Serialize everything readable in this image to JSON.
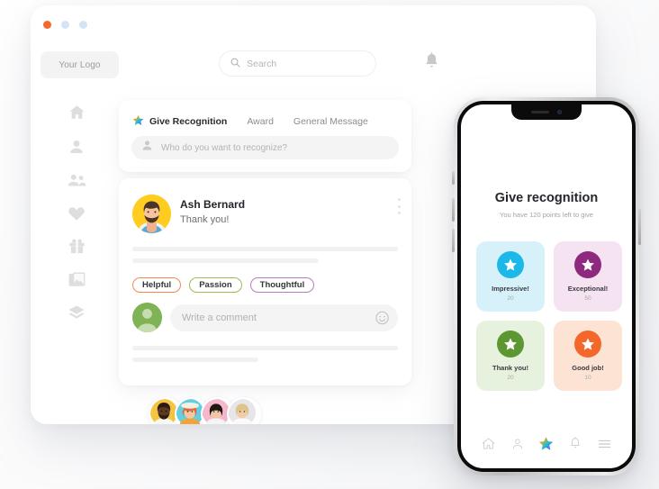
{
  "window": {
    "dots": [
      "#f8682c",
      "#d4e4f7",
      "#d4e4f7"
    ],
    "logo_label": "Your Logo",
    "search": {
      "placeholder": "Search",
      "icon": "search-icon"
    },
    "bell_icon": "bell-icon"
  },
  "sidebar": {
    "items": [
      {
        "icon": "home-icon",
        "name": "home"
      },
      {
        "icon": "person-icon",
        "name": "profile"
      },
      {
        "icon": "people-icon",
        "name": "team"
      },
      {
        "icon": "heart-icon",
        "name": "favorites"
      },
      {
        "icon": "gift-icon",
        "name": "rewards"
      },
      {
        "icon": "images-icon",
        "name": "gallery"
      },
      {
        "icon": "layers-icon",
        "name": "layers"
      }
    ]
  },
  "compose": {
    "tabs": [
      {
        "label": "Give Recognition",
        "active": true,
        "icon": "star-icon"
      },
      {
        "label": "Award",
        "active": false
      },
      {
        "label": "General Message",
        "active": false
      }
    ],
    "recipient_placeholder": "Who do you want to recognize?",
    "recipient_icon": "person-icon"
  },
  "post": {
    "author": "Ash Bernard",
    "message": "Thank you!",
    "menu_icon": "more-vertical-icon",
    "avatar_bg": "#ffcc1f",
    "tags": [
      {
        "label": "Helpful",
        "color": "#f6894d"
      },
      {
        "label": "Passion",
        "color": "#9cbc52"
      },
      {
        "label": "Thoughtful",
        "color": "#b87cc0"
      }
    ],
    "comment_placeholder": "Write a comment",
    "emoji_icon": "smiley-icon"
  },
  "avatar_stack": [
    {
      "name": "avatar-1",
      "bg": "#f5c542"
    },
    {
      "name": "avatar-2",
      "bg": "#63cfe3"
    },
    {
      "name": "avatar-3",
      "bg": "#f7b7cd"
    },
    {
      "name": "avatar-4",
      "bg": "#e6e6e8"
    }
  ],
  "phone": {
    "title": "Give recognition",
    "subtitle": "You have 120 points left to give",
    "rewards": [
      {
        "label": "Impressive!",
        "points": "20",
        "badge": "#1cb8e8",
        "bg": "#d7f1fb",
        "icon": "star-icon"
      },
      {
        "label": "Exceptional!",
        "points": "50",
        "badge": "#8e2a7e",
        "bg": "#f6e3f2",
        "icon": "star-icon"
      },
      {
        "label": "Thank you!",
        "points": "20",
        "badge": "#5d9732",
        "bg": "#e6f2dd",
        "icon": "star-icon"
      },
      {
        "label": "Good job!",
        "points": "10",
        "badge": "#f4672a",
        "bg": "#fde3d4",
        "icon": "star-icon"
      }
    ],
    "nav": [
      {
        "icon": "home-icon",
        "name": "home",
        "active": false
      },
      {
        "icon": "person-icon",
        "name": "profile",
        "active": false
      },
      {
        "icon": "star-icon",
        "name": "recognize",
        "active": true
      },
      {
        "icon": "bell-icon",
        "name": "notifications",
        "active": false
      },
      {
        "icon": "menu-icon",
        "name": "menu",
        "active": false
      }
    ]
  }
}
